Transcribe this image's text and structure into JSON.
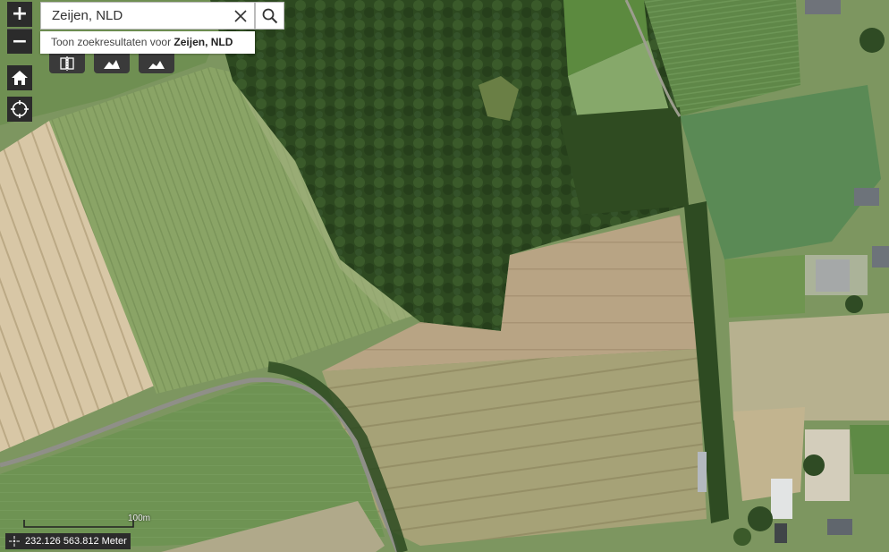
{
  "search": {
    "value": "Zeijen, NLD",
    "suggestion_prefix": "Toon zoekresultaten voor ",
    "suggestion_term": "Zeijen, NLD"
  },
  "zoom": {
    "in_label": "+",
    "out_label": "−"
  },
  "scale": {
    "label": "100m"
  },
  "coordinates": {
    "text": "232.126 563.812 Meter"
  },
  "icons": {
    "home": "home-icon",
    "locate": "locate-icon",
    "search": "search-icon",
    "clear": "close-icon",
    "tool_1": "compare-icon",
    "tool_2": "landscape-icon",
    "tool_3": "landscape-icon",
    "coord": "crosshair-icon"
  },
  "colors": {
    "control_bg": "#2b2b2b",
    "forest": "#2e4a22",
    "field_beige": "#c9b38d",
    "field_green": "#7a9a55",
    "road": "#8c8c88"
  }
}
